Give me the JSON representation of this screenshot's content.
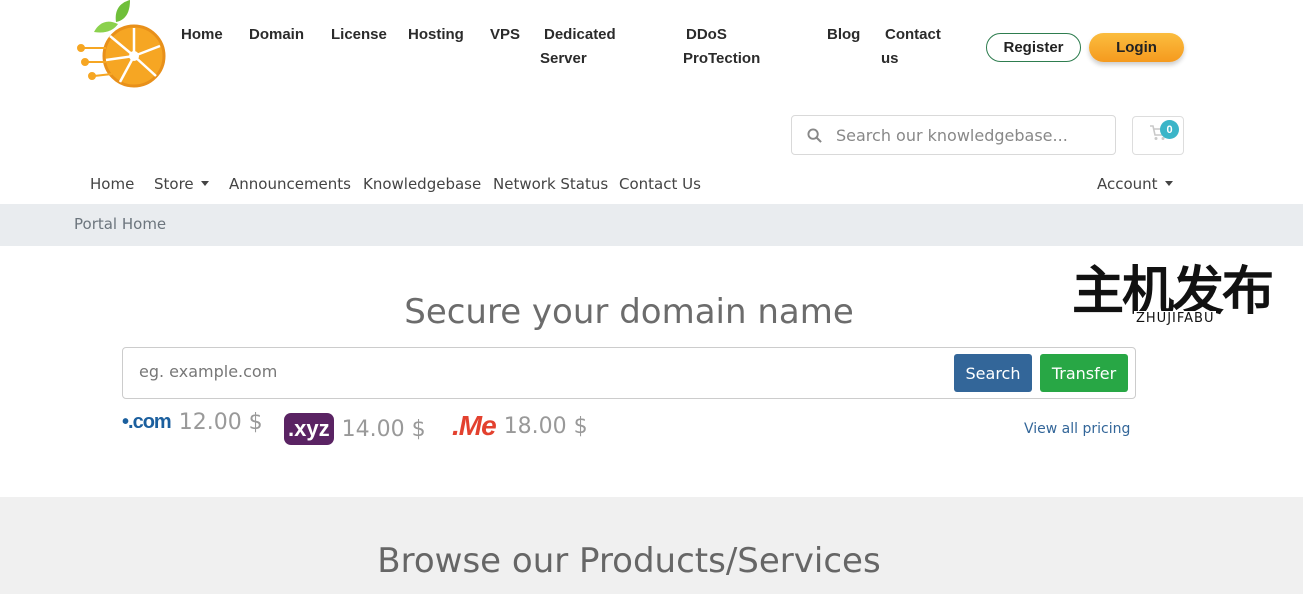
{
  "header": {
    "nav": [
      {
        "label": "Home"
      },
      {
        "label": "Domain"
      },
      {
        "label": "License"
      },
      {
        "label": "Hosting"
      },
      {
        "label": "VPS"
      },
      {
        "label": "Dedicated Server"
      },
      {
        "label": "DDoS ProTection"
      },
      {
        "label": "Blog"
      },
      {
        "label": "Contact us"
      }
    ],
    "register_label": "Register",
    "login_label": "Login"
  },
  "search": {
    "placeholder": "Search our knowledgebase...",
    "search_icon": "search-icon",
    "cart_icon": "shopping-cart-icon",
    "cart_count": "0"
  },
  "subnav": {
    "items": [
      {
        "label": "Home"
      },
      {
        "label": "Store"
      },
      {
        "label": "Announcements"
      },
      {
        "label": "Knowledgebase"
      },
      {
        "label": "Network Status"
      },
      {
        "label": "Contact Us"
      }
    ],
    "account_label": "Account"
  },
  "breadcrumb": {
    "label": "Portal Home"
  },
  "watermark": {
    "cn": "主机发布",
    "en": "ZHUJIFABU"
  },
  "domain": {
    "title": "Secure your domain name",
    "placeholder": "eg. example.com",
    "search_label": "Search",
    "transfer_label": "Transfer",
    "tlds": [
      {
        "name": ".com",
        "price": "12.00 $"
      },
      {
        "name": ".xyz",
        "price": "14.00 $"
      },
      {
        "name": ".Me",
        "price": "18.00 $"
      }
    ],
    "view_pricing": "View all pricing"
  },
  "products": {
    "title": "Browse our Products/Services"
  },
  "colors": {
    "login": "#f7a325",
    "register_border": "#2e7d4f",
    "search_button": "#336699",
    "transfer_button": "#28a745",
    "cart_badge": "#3bb5c8",
    "breadcrumb_bg": "#e9ecef"
  }
}
